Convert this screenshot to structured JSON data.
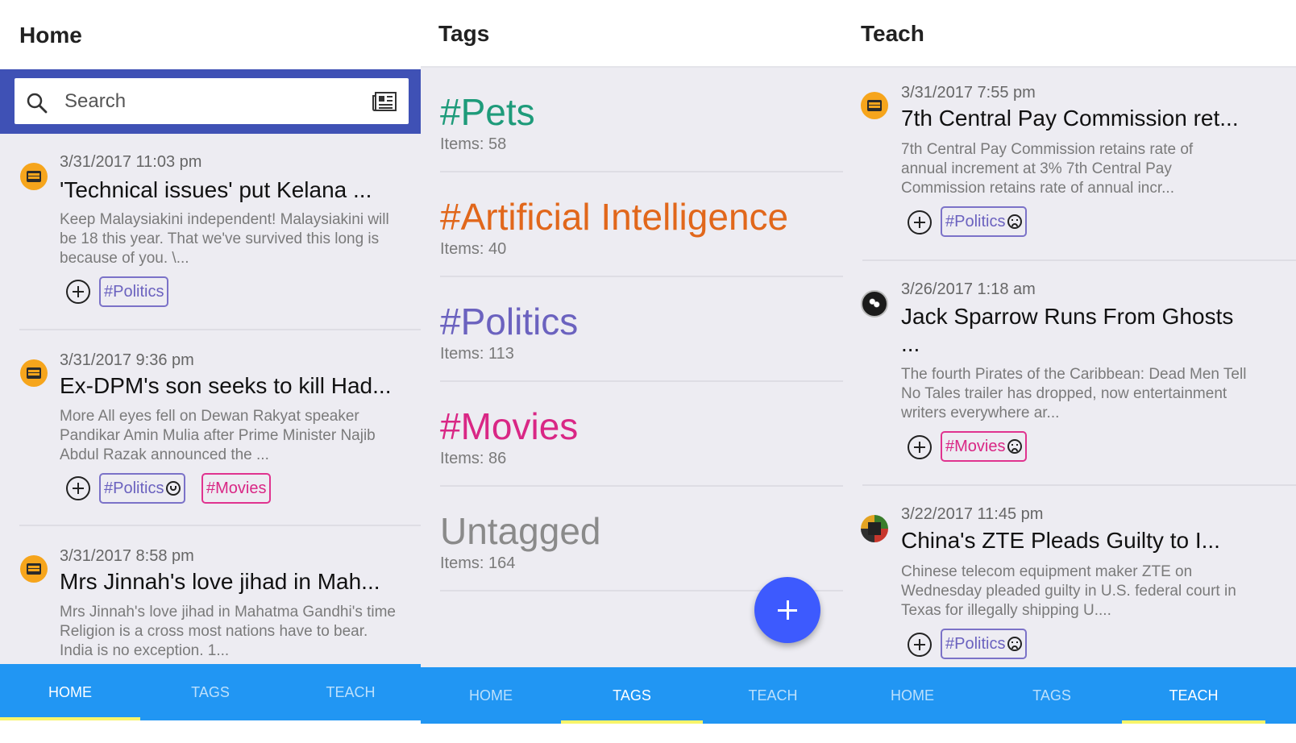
{
  "colors": {
    "primary_blue": "#2196f3",
    "search_band": "#3f51b5",
    "fab": "#3d5afe",
    "tab_indicator": "#f8f46a",
    "politics": "#6b62bf",
    "movies": "#d92785",
    "pets": "#1e9b7a",
    "ai": "#e1671b",
    "untagged": "#8a8a8a"
  },
  "home": {
    "title": "Home",
    "search": {
      "placeholder": "Search",
      "icon": "search-icon",
      "action_icon": "newspaper-icon"
    },
    "articles": [
      {
        "source_icon": "news-icon",
        "date": "3/31/2017 11:03 pm",
        "headline": "'Technical issues' put Kelana ...",
        "desc": "Keep Malaysiakini independent! Malaysiakini will be 18 this year. That we've survived this long is because of you. \\...",
        "tags": [
          {
            "label": "#Politics",
            "mood": ""
          }
        ]
      },
      {
        "source_icon": "news-icon",
        "date": "3/31/2017 9:36 pm",
        "headline": "Ex-DPM's son seeks to kill Had...",
        "desc": "More All eyes fell on Dewan Rakyat speaker Pandikar Amin Mulia after Prime Minister Najib Abdul Razak announced the ...",
        "tags": [
          {
            "label": "#Politics",
            "mood": "happy"
          },
          {
            "label": "#Movies",
            "mood": ""
          }
        ]
      },
      {
        "source_icon": "news-icon",
        "date": "3/31/2017 8:58 pm",
        "headline": "Mrs Jinnah's love jihad in Mah...",
        "desc": "Mrs Jinnah's love jihad in Mahatma Gandhi's time Religion is a cross most nations have to bear. India is no exception. 1...",
        "tags": []
      }
    ]
  },
  "tags": {
    "title": "Tags",
    "items": [
      {
        "name": "#Pets",
        "count": "Items: 58"
      },
      {
        "name": "#Artificial Intelligence",
        "count": "Items: 40"
      },
      {
        "name": "#Politics",
        "count": "Items: 113"
      },
      {
        "name": "#Movies",
        "count": "Items: 86"
      },
      {
        "name": "Untagged",
        "count": "Items: 164"
      }
    ],
    "fab_icon": "plus-icon"
  },
  "teach": {
    "title": "Teach",
    "articles": [
      {
        "source_icon": "news-icon",
        "date": "3/31/2017 7:55 pm",
        "headline": "7th Central Pay Commission ret...",
        "desc": "7th Central Pay Commission retains rate of annual increment at 3% 7th Central Pay Commission retains rate of annual incr...",
        "tag": {
          "label": "#Politics",
          "mood": "sad"
        }
      },
      {
        "source_icon": "pirate-avatar",
        "date": "3/26/2017 1:18 am",
        "headline": "Jack Sparrow Runs From Ghosts ...",
        "desc": "The fourth Pirates of the Caribbean: Dead Men Tell No Tales trailer has dropped, now entertainment writers everywhere ar...",
        "tag": {
          "label": "#Movies",
          "mood": "sad"
        }
      },
      {
        "source_icon": "china-avatar",
        "date": "3/22/2017 11:45 pm",
        "headline": "China's ZTE Pleads Guilty to I...",
        "desc": "Chinese telecom equipment maker ZTE on Wednesday pleaded guilty in U.S. federal court in Texas for illegally shipping U....",
        "tag": {
          "label": "#Politics",
          "mood": "sad"
        }
      }
    ]
  },
  "nav": {
    "home": "HOME",
    "tags": "TAGS",
    "teach": "TEACH"
  }
}
